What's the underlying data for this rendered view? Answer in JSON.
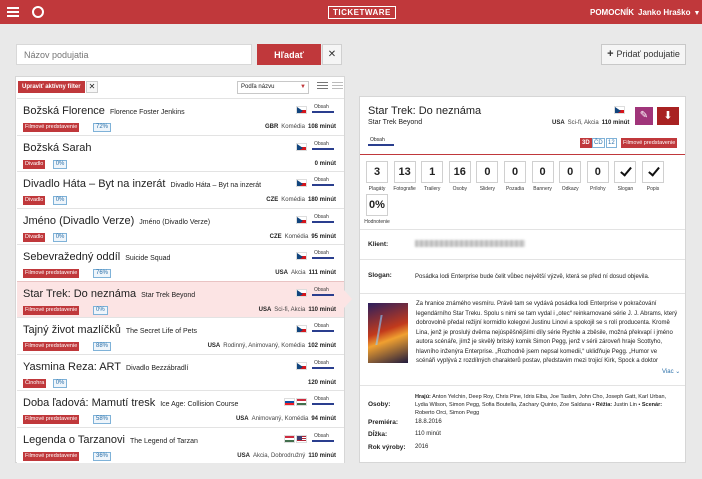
{
  "topbar": {
    "brand": "TICKETWARE",
    "help": "POMOCNÍK",
    "user": "Janko Hraško",
    "user_caret": "▼"
  },
  "search": {
    "placeholder": "Názov podujatia",
    "button": "Hľadať",
    "clear": "✕",
    "add_button": "Pridať podujatie",
    "add_plus": "+"
  },
  "list": {
    "filter_button": "Upraviť aktívny filter",
    "filter_clear": "✕",
    "sort": "Podľa názvu",
    "content_label": "Obsah",
    "items": [
      {
        "title": "Božská Florence",
        "original": "Florence Foster Jenkins",
        "category": "Filmové predstavenie",
        "percent": "72%",
        "country": "GBR",
        "genre": "Komédia",
        "duration": "108 minút",
        "flags": [
          "cz"
        ]
      },
      {
        "title": "Božská Sarah",
        "original": "",
        "category": "Divadlo",
        "percent": "0%",
        "country": "",
        "genre": "",
        "duration": "0 minút",
        "flags": [
          "cz"
        ]
      },
      {
        "title": "Divadlo Háta – Byt na inzerát",
        "original": "Divadlo Háta – Byt na inzerát",
        "category": "Divadlo",
        "percent": "0%",
        "country": "CZE",
        "genre": "Komédia",
        "duration": "180 minút",
        "flags": [
          "cz"
        ]
      },
      {
        "title": "Jméno (Divadlo Verze)",
        "original": "Jméno (Divadlo Verze)",
        "category": "Divadlo",
        "percent": "0%",
        "country": "CZE",
        "genre": "Komédia",
        "duration": "95 minút",
        "flags": [
          "cz"
        ]
      },
      {
        "title": "Sebevražedný oddíl",
        "original": "Suicide Squad",
        "category": "Filmové predstavenie",
        "percent": "76%",
        "country": "USA",
        "genre": "Akcia",
        "duration": "111 minút",
        "flags": [
          "cz"
        ]
      },
      {
        "title": "Star Trek: Do neznáma",
        "original": "Star Trek Beyond",
        "category": "Filmové predstavenie",
        "percent": "0%",
        "country": "USA",
        "genre": "Sci-fi, Akcia",
        "duration": "110 minút",
        "flags": [
          "cz"
        ]
      },
      {
        "title": "Tajný život mazlíčků",
        "original": "The Secret Life of Pets",
        "category": "Filmové predstavenie",
        "percent": "88%",
        "country": "USA",
        "genre": "Rodinný, Animovaný, Komédia",
        "duration": "102 minút",
        "flags": [
          "cz"
        ]
      },
      {
        "title": "Yasmina Reza: ART",
        "original": "Divadlo Bezzábradlí",
        "category": "Činohra",
        "percent": "0%",
        "country": "",
        "genre": "",
        "duration": "120 minút",
        "flags": [
          "cz"
        ]
      },
      {
        "title": "Doba ľadová: Mamutí tresk",
        "original": "Ice Age: Collision Course",
        "category": "Filmové predstavenie",
        "percent": "58%",
        "country": "USA",
        "genre": "Animovaný, Komédia",
        "duration": "94 minút",
        "flags": [
          "sk",
          "hu"
        ]
      },
      {
        "title": "Legenda o Tarzanovi",
        "original": "The Legend of Tarzan",
        "category": "Filmové predstavenie",
        "percent": "36%",
        "country": "USA",
        "genre": "Akcia, Dobrodružný",
        "duration": "110 minút",
        "flags": [
          "hu",
          "us"
        ]
      }
    ]
  },
  "detail": {
    "title": "Star Trek: Do neznáma",
    "original": "Star Trek Beyond",
    "country": "USA",
    "genre": "Sci-fi, Akcia",
    "duration": "110 minút",
    "content_label": "Obsah",
    "formats": [
      "3D",
      "ČD",
      "12"
    ],
    "category": "Filmové predstavenie",
    "edit_icon": "✎",
    "download_icon": "⬇",
    "stats": [
      {
        "value": "3",
        "label": "Plagáty"
      },
      {
        "value": "13",
        "label": "Fotografie"
      },
      {
        "value": "1",
        "label": "Trailery"
      },
      {
        "value": "16",
        "label": "Osoby"
      },
      {
        "value": "0",
        "label": "Slidery"
      },
      {
        "value": "0",
        "label": "Pozadia"
      },
      {
        "value": "0",
        "label": "Bannery"
      },
      {
        "value": "0",
        "label": "Odkazy"
      },
      {
        "value": "0",
        "label": "Prílohy"
      }
    ],
    "checks": [
      {
        "label": "Slogan"
      },
      {
        "label": "Popis"
      }
    ],
    "rating": {
      "value": "0%",
      "label": "Hodnotenie"
    },
    "client_label": "Klient:",
    "slogan_label": "Slogan:",
    "slogan": "Posádka lodi Enterprise bude čelit vůbec největší výzvě, která se před ní dosud objevila.",
    "description": "Za hranice známého vesmíru. Právě tam se vydává posádka lodi Enterprise v pokračování legendárního Star Treku. Spolu s nimi se tam vydal i „otec“ reinkarnované série J. J. Abrams, který dobrovolně předal režijní kormidlo kolegovi Justinu Linovi a spokojil se s rolí producenta. Kromě Lina, jenž je proslulý dvěma nejúspěšnějšími díly série Rychle a zběsile, možná překvapí i jméno autora scénáře, jímž je skvělý britský komik Simon Pegg, jenž v sérii zároveň hraje Scottyho, hlavního inženýra Enterprise. „Rozhodně jsem nepsal komedii,“ ukliďňuje Pegg. „Humor ve scénáři vyplývá z rozdílných charakterů postav, představim mezi trojicí Kirk, Spock a doktor",
    "more": "Viac",
    "people_label": "Osoby:",
    "people_actors_label": "Hrajú:",
    "people_actors": "Anton Yelchin, Deep Roy, Chris Pine, Idris Elba, Joe Taslim, John Cho, Joseph Gatt, Karl Urban, Lydia Wilson, Simon Pegg, Sofia Boutella, Zachary Quinto, Zoe Saldana",
    "people_director_label": "Réžia:",
    "people_director": "Justin Lin",
    "people_writer_label": "Scenár:",
    "people_writer": "Roberto Orci, Simon Pegg",
    "premiere_label": "Premiéra:",
    "premiere": "18.8.2016",
    "length_label": "Dĺžka:",
    "length": "110 minút",
    "year_label": "Rok výroby:",
    "year": "2016"
  }
}
